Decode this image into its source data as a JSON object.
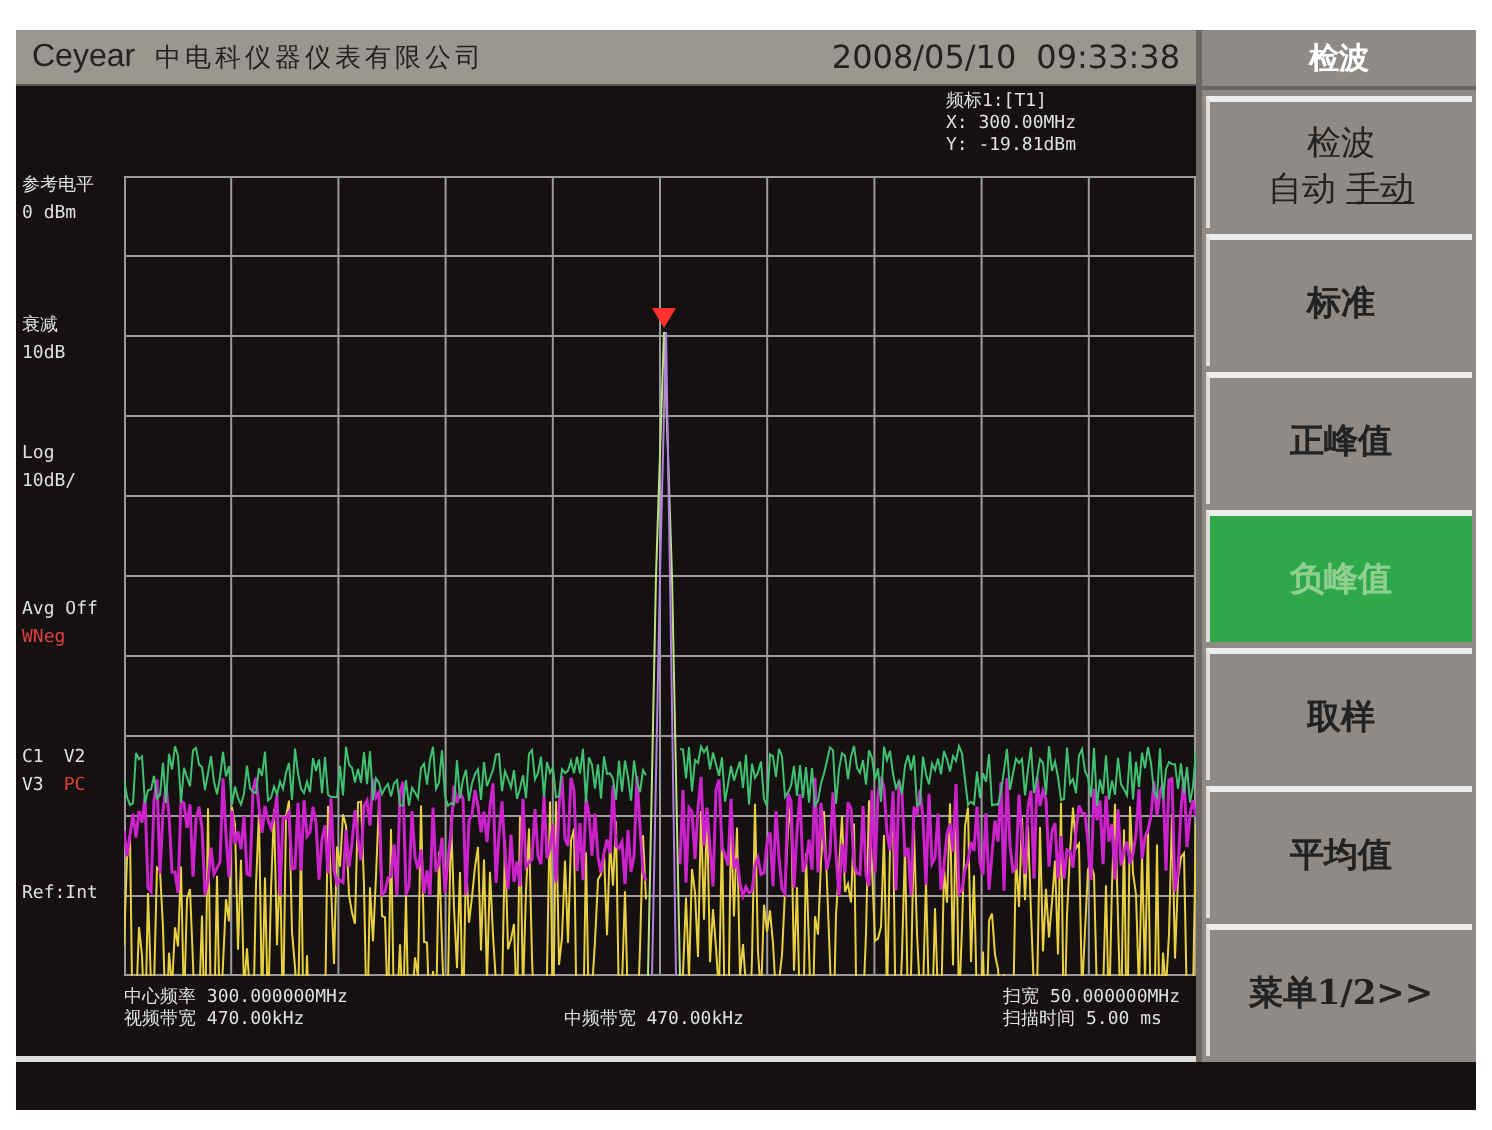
{
  "header": {
    "brand": "Ceyear",
    "company": "中电科仪器仪表有限公司",
    "date": "2008/05/10",
    "time": "09:33:38"
  },
  "menu": {
    "title": "检波",
    "keys": [
      {
        "kind": "toggle",
        "title": "检波",
        "options": [
          {
            "label": "自动",
            "selected": false
          },
          {
            "label": "手动",
            "selected": true
          }
        ]
      },
      {
        "kind": "plain",
        "label": "标准",
        "selected": false
      },
      {
        "kind": "plain",
        "label": "正峰值",
        "selected": false
      },
      {
        "kind": "plain",
        "label": "负峰值",
        "selected": true
      },
      {
        "kind": "plain",
        "label": "取样",
        "selected": false
      },
      {
        "kind": "plain",
        "label": "平均值",
        "selected": false
      },
      {
        "kind": "plain",
        "label": "菜单1/2>>",
        "selected": false
      }
    ]
  },
  "marker": {
    "lines": [
      "频标1:[T1]",
      "X: 300.00MHz",
      "Y: -19.81dBm"
    ]
  },
  "annotations": [
    {
      "lines": [
        [
          {
            "text": "参考电平",
            "color": "#e0e0e0"
          }
        ],
        [
          {
            "text": "0  dBm",
            "color": "#e0e0e0"
          }
        ]
      ]
    },
    {
      "lines": [
        [
          {
            "text": "衰减",
            "color": "#e0e0e0"
          }
        ],
        [
          {
            "text": "10dB",
            "color": "#e0e0e0"
          }
        ]
      ]
    },
    {
      "lines": [
        [
          {
            "text": "Log",
            "color": "#e0e0e0"
          }
        ],
        [
          {
            "text": "10dB/",
            "color": "#e0e0e0"
          }
        ]
      ]
    },
    {
      "lines": [
        [
          {
            "text": "Avg Off",
            "color": "#e0e0e0"
          }
        ],
        [
          {
            "text": "WNeg",
            "color": "#e04040"
          }
        ]
      ]
    },
    {
      "lines": [
        [
          {
            "text": "C1",
            "color": "#e0e0e0"
          },
          {
            "text": "V2",
            "color": "#e0e0e0"
          }
        ],
        [
          {
            "text": "V3",
            "color": "#e0e0e0"
          },
          {
            "text": "PC",
            "color": "#e04040"
          }
        ]
      ]
    },
    {
      "lines": [
        [
          {
            "text": "Ref:Int",
            "color": "#e0e0e0"
          }
        ]
      ]
    }
  ],
  "footer": {
    "left": [
      "中心频率 300.000000MHz",
      "视频带宽 470.00kHz"
    ],
    "middle": "中频带宽 470.00kHz",
    "right": [
      "扫宽 50.000000MHz",
      "扫描时间 5.00  ms"
    ]
  }
}
